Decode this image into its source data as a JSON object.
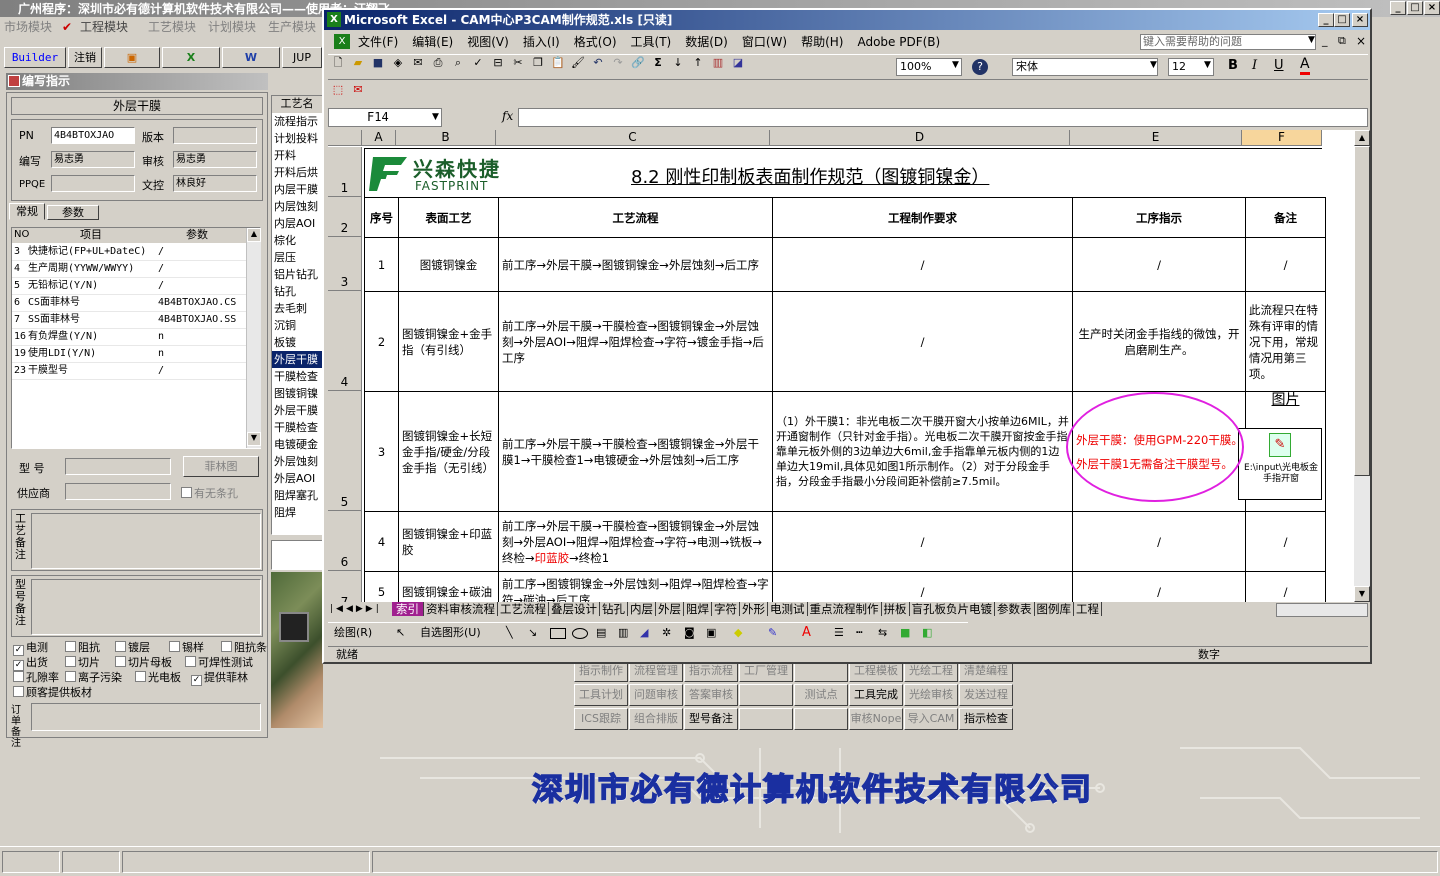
{
  "app_title": "广州程序：深圳市必有德计算机软件技术有限公司——使用者：汪翔飞",
  "app_top_right_text": "者：汪翔飞",
  "module_bar": [
    "市场模块",
    "工程模块",
    "工艺模块",
    "计划模块",
    "生产模块"
  ],
  "toolbar": {
    "builder": "Builder",
    "logout": "注销",
    "jup": "JUP"
  },
  "panel_title": "编写指示",
  "form": {
    "header": "外层干膜",
    "pn_label": "PN",
    "pn_value": "4B4BTOXJAO",
    "version_label": "版本",
    "version_value": "",
    "writer_label": "编写",
    "writer_value": "易志勇",
    "reviewer_label": "审核",
    "reviewer_value": "易志勇",
    "ppqe_label": "PPQE",
    "ppqe_value": "",
    "control_label": "文控",
    "control_value": "林良好",
    "tab1": "常规",
    "tab2": "参数",
    "param_headers": [
      "NO",
      "项目",
      "参数"
    ],
    "params": [
      {
        "no": "3",
        "item": "快捷标记(FP+UL+DateC)",
        "val": "/"
      },
      {
        "no": "4",
        "item": "生产周期(YYWW/WWYY)",
        "val": "/"
      },
      {
        "no": "5",
        "item": "无铅标记(Y/N)",
        "val": "/"
      },
      {
        "no": "6",
        "item": "CS面菲林号",
        "val": "4B4BTOXJAO.CS"
      },
      {
        "no": "7",
        "item": "SS面菲林号",
        "val": "4B4BTOXJAO.SS"
      },
      {
        "no": "16",
        "item": "有负焊盘(Y/N)",
        "val": "n"
      },
      {
        "no": "19",
        "item": "使用LDI(Y/N)",
        "val": "n"
      },
      {
        "no": "23",
        "item": "干膜型号",
        "val": "/"
      }
    ],
    "model_label": "型 号",
    "film_button": "菲林图",
    "supplier_label": "供应商",
    "no_holes": "有无条孔",
    "process_note_label": "工艺备注",
    "model_note_label": "型号备注",
    "order_note_label": "订单备注",
    "checkboxes": [
      [
        {
          "label": "电测",
          "checked": true
        },
        {
          "label": "阻抗",
          "checked": false
        },
        {
          "label": "镀层",
          "checked": false
        },
        {
          "label": "锡样",
          "checked": false
        },
        {
          "label": "阻抗条",
          "checked": false
        }
      ],
      [
        {
          "label": "出货",
          "checked": true
        },
        {
          "label": "切片",
          "checked": false
        },
        {
          "label": "切片母板",
          "checked": false
        },
        {
          "label": "可焊性测试",
          "checked": false
        }
      ],
      [
        {
          "label": "孔隙率",
          "checked": false
        },
        {
          "label": "离子污染",
          "checked": false
        },
        {
          "label": "光电板",
          "checked": false
        },
        {
          "label": "提供菲林",
          "checked": true
        }
      ],
      [
        {
          "label": "顾客提供板材",
          "checked": false
        }
      ]
    ]
  },
  "process_list": {
    "header": "工艺名",
    "items": [
      "流程指示",
      "计划投料",
      "开料",
      "开料后烘",
      "内层干膜",
      "内层蚀刻",
      "内层AOI",
      "棕化",
      "层压",
      "铝片钻孔",
      "钻孔",
      "去毛刺",
      "沉铜",
      "板镀",
      "外层干膜",
      "干膜检查",
      "图镀铜镍",
      "外层干膜",
      "干膜检查",
      "电镀硬金",
      "外层蚀刻",
      "外层AOI",
      "阻焊塞孔",
      "阻焊"
    ],
    "selected_index": 14
  },
  "bottom_buttons": [
    [
      "指示制作",
      "流程管理",
      "指示流程",
      "工厂管理",
      "",
      "工程模板",
      "光绘工程",
      "清楚编程"
    ],
    [
      "工具计划",
      "问题审核",
      "答案审核",
      "",
      "测试点",
      "工具完成",
      "光绘审核",
      "发送过程"
    ],
    [
      "ICS跟踪",
      "组合排版",
      "型号备注",
      "",
      "",
      "审核Nope",
      "导入CAM",
      "指示检查"
    ]
  ],
  "company_banner": "深圳市必有德计算机软件技术有限公司",
  "excel": {
    "title": "Microsoft Excel - CAM中心P3CAM制作规范.xls [只读]",
    "menu": [
      "文件(F)",
      "编辑(E)",
      "视图(V)",
      "插入(I)",
      "格式(O)",
      "工具(T)",
      "数据(D)",
      "窗口(W)",
      "帮助(H)",
      "Adobe PDF(B)"
    ],
    "help_placeholder": "键入需要帮助的问题",
    "zoom": "100%",
    "font": "宋体",
    "font_size": "12",
    "name_box": "F14",
    "fx": "fx",
    "columns": [
      "A",
      "B",
      "C",
      "D",
      "E",
      "F"
    ],
    "logo_cn": "兴森快捷",
    "logo_en": "FASTPRINT",
    "doc_title": "8.2 刚性印制板表面制作规范（图镀铜镍金）",
    "table_headers": [
      "序号",
      "表面工艺",
      "工艺流程",
      "工程制作要求",
      "工序指示",
      "备注"
    ],
    "rows": [
      {
        "no": "1",
        "surface": "图镀铜镍金",
        "flow": "前工序→外层干膜→图镀铜镍金→外层蚀刻→后工序",
        "req": "/",
        "instr": "/",
        "note": "/"
      },
      {
        "no": "2",
        "surface": "图镀铜镍金+金手指（有引线）",
        "flow": "前工序→外层干膜→干膜检查→图镀铜镍金→外层蚀刻→外层AOI→阻焊→阻焊检查→字符→镀金手指→后工序",
        "req": "/",
        "instr": "生产时关闭金手指线的微蚀，开启磨刷生产。",
        "note": "此流程只在特殊有评审的情况下用，常规情况用第三项。"
      },
      {
        "no": "3",
        "surface": "图镀铜镍金+长短金手指/硬金/分段金手指（无引线）",
        "flow": "前工序→外层干膜→干膜检查→图镀铜镍金→外层干膜1→干膜检查1→电镀硬金→外层蚀刻→后工序",
        "req": "（1）外干膜1：非光电板二次干膜开窗大小按单边6MIL，并开通窗制作（只针对金手指）。光电板二次干膜开窗按金手指靠单元板外侧的3边单边大6mil,金手指靠单元板内侧的1边单边大19mil,具体见如图1所示制作。（2）对于分段金手指，分段金手指最小分段间距补偿前≥7.5mil。",
        "instr_red1": "外层干膜：使用GPM-220干膜。",
        "instr_red2": "外层干膜1无需备注干膜型号。",
        "note_title": "图片",
        "note_caption": "E:\\input\\光电板金手指开窗"
      },
      {
        "no": "4",
        "surface": "图镀铜镍金+印蓝胶",
        "flow_pre": "前工序→外层干膜→干膜检查→图镀铜镍金→外层蚀刻→外层AOI→阻焊→阻焊检查→字符→电测→铣板→终检→",
        "flow_red": "印蓝胶",
        "flow_post": "→终检1",
        "req": "/",
        "instr": "/",
        "note": "/"
      },
      {
        "no": "5",
        "surface": "图镀铜镍金+碳油",
        "flow": "前工序→图镀铜镍金→外层蚀刻→阻焊→阻焊检查→字符→碳油→后工序",
        "req": "/",
        "instr": "/",
        "note": "/"
      }
    ],
    "row_numbers": [
      "1",
      "2",
      "3",
      "4",
      "5",
      "6",
      "7"
    ],
    "sheet_tabs": [
      "索引",
      "资料审核流程",
      "工艺流程",
      "叠层设计",
      "钻孔",
      "内层",
      "外层",
      "阻焊",
      "字符",
      "外形",
      "电测试",
      "重点流程制作",
      "拼板",
      "盲孔板负片电镀",
      "参数表",
      "图例库",
      "工程"
    ],
    "draw_label": "绘图(R)",
    "autoshape_label": "自选图形(U)",
    "status_left": "就绪",
    "status_right": "数字"
  },
  "top_right_controls": [
    "_",
    "□",
    "×"
  ]
}
